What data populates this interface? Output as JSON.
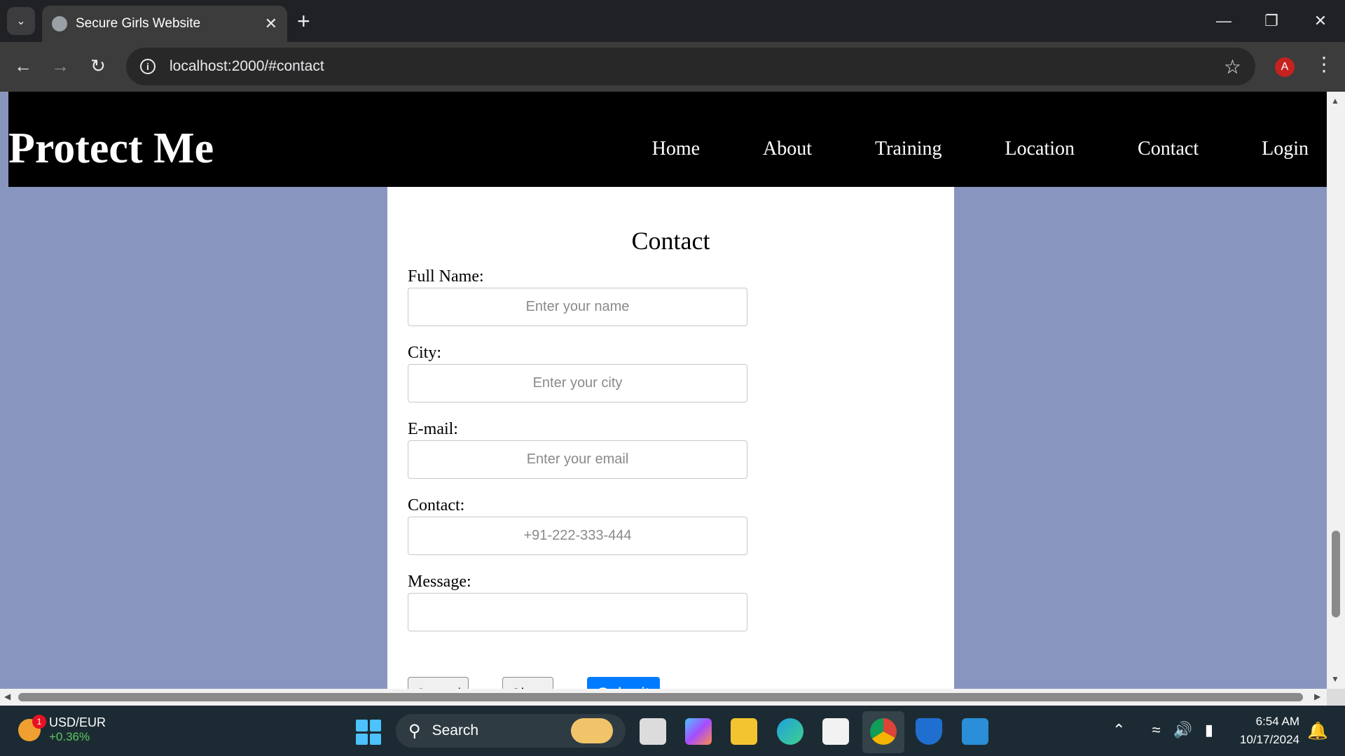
{
  "browser": {
    "tab_title": "Secure Girls Website",
    "url": "localhost:2000/#contact",
    "profile_initial": "A"
  },
  "site": {
    "logo": "Protect Me",
    "nav": [
      "Home",
      "About",
      "Training",
      "Location",
      "Contact",
      "Login"
    ]
  },
  "contact_form": {
    "title": "Contact",
    "fields": [
      {
        "label": "Full Name:",
        "placeholder": "Enter your name",
        "value": ""
      },
      {
        "label": "City:",
        "placeholder": "Enter your city",
        "value": ""
      },
      {
        "label": "E-mail:",
        "placeholder": "Enter your email",
        "value": ""
      },
      {
        "label": "Contact:",
        "placeholder": "+91-222-333-444",
        "value": ""
      },
      {
        "label": "Message:",
        "placeholder": "",
        "value": ""
      }
    ],
    "buttons": {
      "cancel": "Cancel",
      "clear": "Clear",
      "submit": "Submit"
    }
  },
  "taskbar": {
    "widget_title": "USD/EUR",
    "widget_change": "+0.36%",
    "widget_badge": "1",
    "search_label": "Search",
    "time": "6:54 AM",
    "date": "10/17/2024"
  },
  "colors": {
    "page_background": "#8896bf",
    "header_background": "#000000",
    "submit_button": "#007bff"
  }
}
